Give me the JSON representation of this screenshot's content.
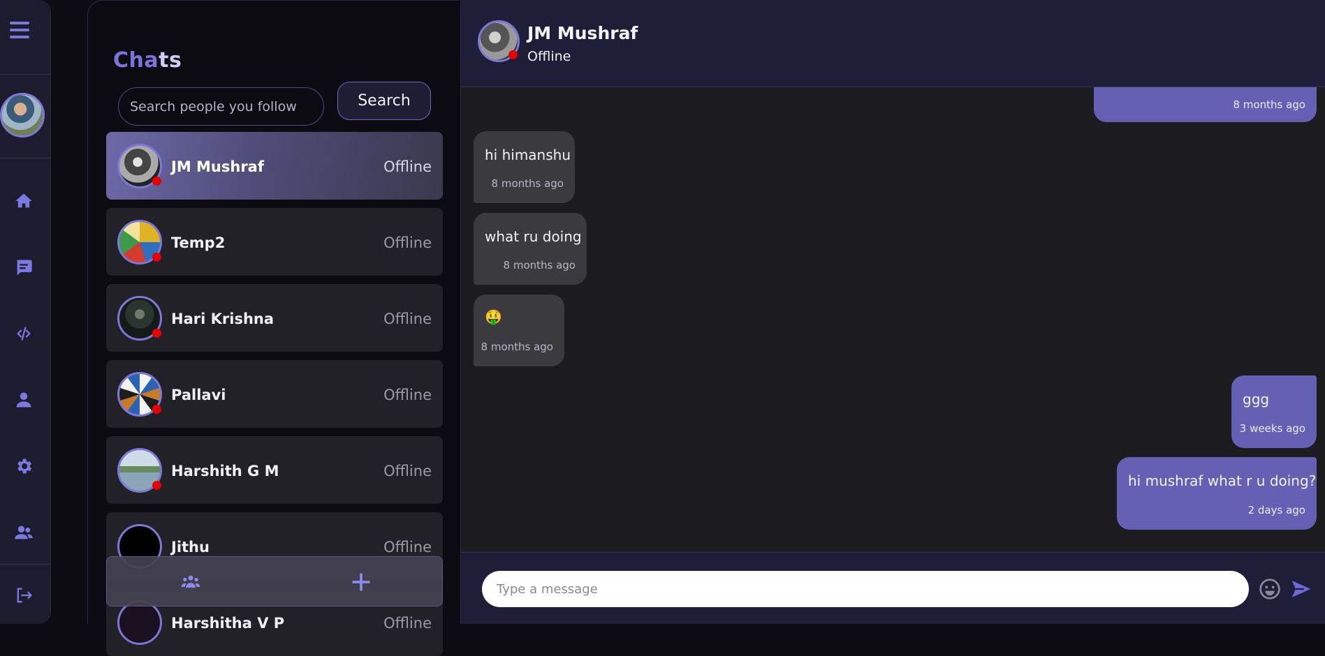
{
  "sidebar": {
    "icons": [
      "menu-icon",
      "home-icon",
      "chat-icon",
      "code-icon",
      "user-icon",
      "gear-icon",
      "users-icon",
      "logout-icon"
    ]
  },
  "chat_list": {
    "title_part1": "Cha",
    "title_part2": "ts",
    "search_placeholder": "Search people you follow",
    "search_value": "",
    "search_button": "Search",
    "contacts": [
      {
        "name": "JM Mushraf",
        "status": "Offline",
        "active": true
      },
      {
        "name": "Temp2",
        "status": "Offline"
      },
      {
        "name": "Hari Krishna",
        "status": "Offline"
      },
      {
        "name": "Pallavi",
        "status": "Offline"
      },
      {
        "name": "Harshith G M",
        "status": "Offline"
      },
      {
        "name": "Jithu",
        "status": "Offline"
      },
      {
        "name": "Harshitha V P",
        "status": "Offline"
      }
    ],
    "bottom_bar_icons": [
      "group-icon",
      "plus-icon"
    ]
  },
  "conversation": {
    "contact_name": "JM Mushraf",
    "contact_status": "Offline",
    "messages": [
      {
        "direction": "out",
        "text": "",
        "time": "8 months ago"
      },
      {
        "direction": "in",
        "text": "hi himanshu",
        "time": "8 months ago"
      },
      {
        "direction": "in",
        "text": "what ru doing",
        "time": "8 months ago"
      },
      {
        "direction": "in",
        "text": "🤑",
        "time": "8 months ago"
      },
      {
        "direction": "out",
        "text": "ggg",
        "time": "3 weeks ago"
      },
      {
        "direction": "out",
        "text": "hi mushraf what r u doing?",
        "time": "2 days ago"
      }
    ],
    "input_placeholder": "Type a message",
    "input_value": ""
  },
  "colors": {
    "accent": "#7a74dc",
    "outgoing_bubble": "#6560b3",
    "incoming_bubble": "#3b3a3f",
    "offline_dot": "#e60000",
    "header_bg": "#1f1e38"
  }
}
